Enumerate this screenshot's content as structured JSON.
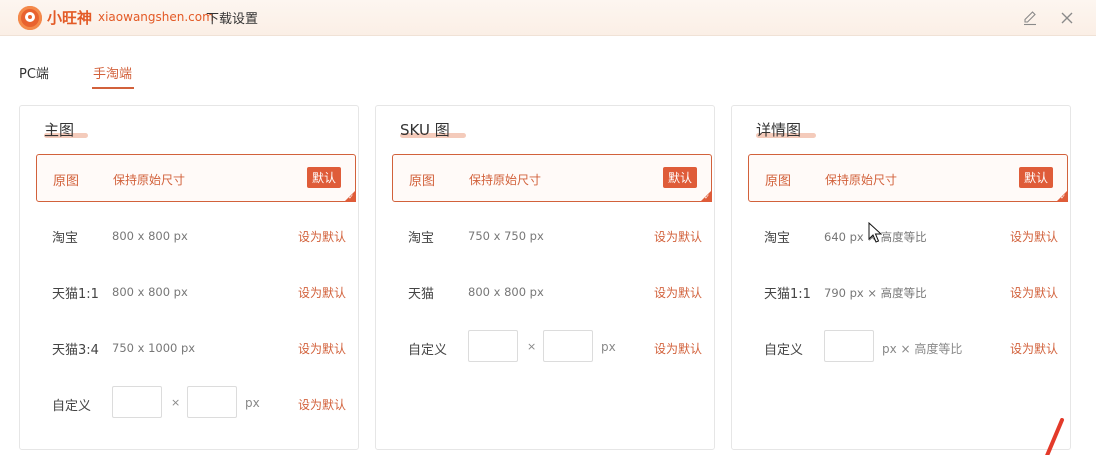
{
  "titlebar": {
    "brand": "小旺神",
    "domain": "xiaowangshen.com",
    "title": "下载设置"
  },
  "tabs": [
    {
      "label": "PC端",
      "active": false
    },
    {
      "label": "手淘端",
      "active": true
    }
  ],
  "panels": {
    "main": {
      "title": "主图",
      "original": {
        "name": "原图",
        "spec": "保持原始尺寸",
        "badge": "默认"
      },
      "rows": [
        {
          "name": "淘宝",
          "spec": "800 x 800 px",
          "action": "设为默认"
        },
        {
          "name": "天猫1:1",
          "spec": "800 x 800 px",
          "action": "设为默认"
        },
        {
          "name": "天猫3:4",
          "spec": "750 x 1000 px",
          "action": "设为默认"
        }
      ],
      "custom": {
        "name": "自定义",
        "times": "×",
        "unit": "px",
        "action": "设为默认"
      }
    },
    "sku": {
      "title": "SKU 图",
      "original": {
        "name": "原图",
        "spec": "保持原始尺寸",
        "badge": "默认"
      },
      "rows": [
        {
          "name": "淘宝",
          "spec": "750 x 750 px",
          "action": "设为默认"
        },
        {
          "name": "天猫",
          "spec": "800 x 800 px",
          "action": "设为默认"
        }
      ],
      "custom": {
        "name": "自定义",
        "times": "×",
        "unit": "px",
        "action": "设为默认"
      }
    },
    "detail": {
      "title": "详情图",
      "original": {
        "name": "原图",
        "spec": "保持原始尺寸",
        "badge": "默认"
      },
      "rows": [
        {
          "name": "淘宝",
          "spec": "640 px × 高度等比",
          "action": "设为默认"
        },
        {
          "name": "天猫1:1",
          "spec": "790 px × 高度等比",
          "action": "设为默认"
        }
      ],
      "custom": {
        "name": "自定义",
        "unit": "px × 高度等比",
        "action": "设为默认"
      }
    }
  },
  "colors": {
    "accent": "#d2613b",
    "badge": "#df5c39",
    "brand": "#e35a26"
  },
  "icons": {
    "edit": "edit-icon",
    "close": "close-icon",
    "logo": "logo-icon"
  }
}
